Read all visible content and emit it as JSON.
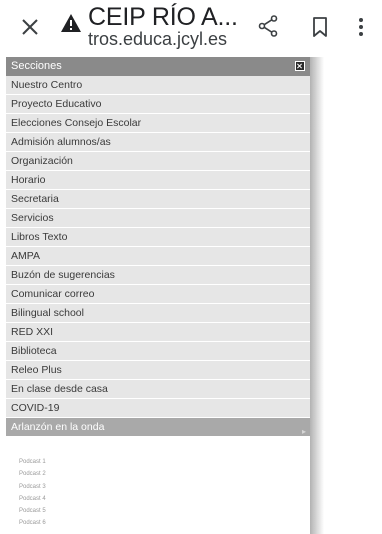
{
  "browser": {
    "title": "CEIP RÍO A...",
    "url": "tros.educa.jcyl.es",
    "icons": {
      "close": "close-icon",
      "warning": "warning-icon",
      "share": "share-icon",
      "bookmark": "bookmark-icon",
      "more": "more-vert-icon"
    }
  },
  "menu": {
    "header": "Secciones",
    "items": [
      "Nuestro Centro",
      "Proyecto Educativo",
      "Elecciones Consejo Escolar",
      "Admisión alumnos/as",
      "Organización",
      "Horario",
      "Secretaria",
      "Servicios",
      "Libros Texto",
      "AMPA",
      "Buzón de sugerencias",
      "Comunicar correo",
      "Bilingual school",
      "RED XXI",
      "Biblioteca",
      "Releo Plus",
      "En clase desde casa",
      "COVID-19"
    ],
    "active_item": "Arlanzón en la onda",
    "sub_items": [
      "Podcast 1",
      "Podcast 2",
      "Podcast 3",
      "Podcast 4",
      "Podcast 5",
      "Podcast 6"
    ]
  },
  "colors": {
    "header_bg": "#8a8a8a",
    "item_bg": "#e6e6e6",
    "active_bg": "#a9a9a9",
    "warning": "#202124"
  }
}
